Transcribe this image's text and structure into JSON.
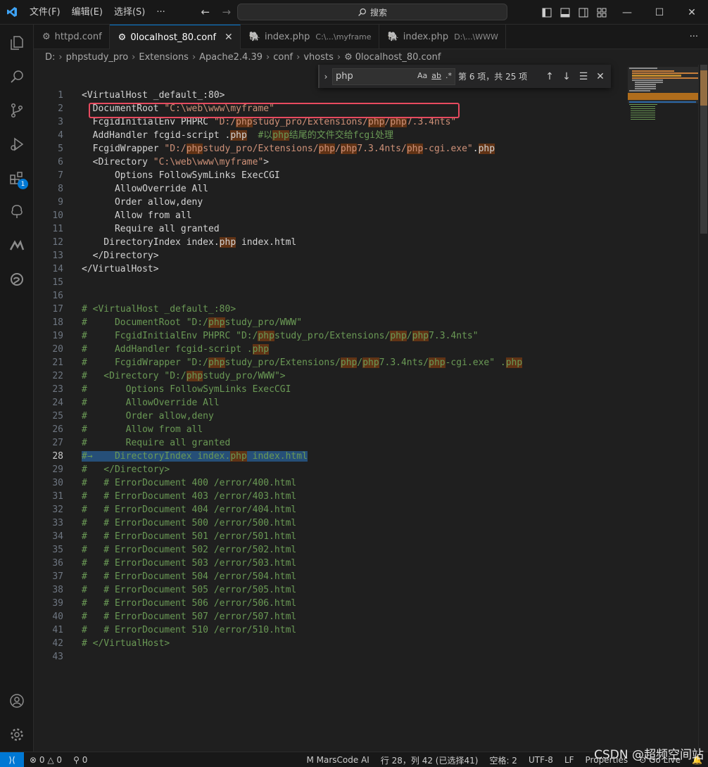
{
  "menu": [
    "文件(F)",
    "编辑(E)",
    "选择(S)",
    "···"
  ],
  "search": {
    "label": "搜索"
  },
  "tabs": [
    {
      "label": "httpd.conf",
      "path": ""
    },
    {
      "label": "0localhost_80.conf",
      "path": ""
    },
    {
      "label": "index.php",
      "path": "C:\\...\\myframe"
    },
    {
      "label": "index.php",
      "path": "D:\\...\\WWW"
    }
  ],
  "breadcrumb": [
    "D:",
    "phpstudy_pro",
    "Extensions",
    "Apache2.4.39",
    "conf",
    "vhosts",
    "0localhost_80.conf"
  ],
  "find": {
    "query": "php",
    "count": "第 6 项，共 25 项"
  },
  "activity_badge": "1",
  "colors": {
    "accent": "#0078d4",
    "comment": "#6a9955",
    "string": "#ce9178",
    "highlight_box": "#e84a5f",
    "match": "#613315"
  },
  "code_lines": [
    {
      "n": "1",
      "t": "<VirtualHost _default_:80>"
    },
    {
      "n": "2",
      "t": "  DocumentRoot \"C:\\web\\www\\myframe\""
    },
    {
      "n": "3",
      "t": "  FcgidInitialEnv PHPRC \"D:/phpstudy_pro/Extensions/php/php7.3.4nts\""
    },
    {
      "n": "4",
      "t": "  AddHandler fcgid-script .php  #以php结尾的文件交给fcgi处理"
    },
    {
      "n": "5",
      "t": "  FcgidWrapper \"D:/phpstudy_pro/Extensions/php/php7.3.4nts/php-cgi.exe\".php"
    },
    {
      "n": "6",
      "t": "  <Directory \"C:\\web\\www\\myframe\">"
    },
    {
      "n": "7",
      "t": "      Options FollowSymLinks ExecCGI"
    },
    {
      "n": "8",
      "t": "      AllowOverride All"
    },
    {
      "n": "9",
      "t": "      Order allow,deny"
    },
    {
      "n": "10",
      "t": "      Allow from all"
    },
    {
      "n": "11",
      "t": "      Require all granted"
    },
    {
      "n": "12",
      "t": "    DirectoryIndex index.php index.html"
    },
    {
      "n": "13",
      "t": "  </Directory>"
    },
    {
      "n": "14",
      "t": "</VirtualHost>"
    },
    {
      "n": "15",
      "t": ""
    },
    {
      "n": "16",
      "t": ""
    },
    {
      "n": "17",
      "t": "# <VirtualHost _default_:80>"
    },
    {
      "n": "18",
      "t": "#     DocumentRoot \"D:/phpstudy_pro/WWW\""
    },
    {
      "n": "19",
      "t": "#     FcgidInitialEnv PHPRC \"D:/phpstudy_pro/Extensions/php/php7.3.4nts\""
    },
    {
      "n": "20",
      "t": "#     AddHandler fcgid-script .php"
    },
    {
      "n": "21",
      "t": "#     FcgidWrapper \"D:/phpstudy_pro/Extensions/php/php7.3.4nts/php-cgi.exe\" .php"
    },
    {
      "n": "22",
      "t": "#   <Directory \"D:/phpstudy_pro/WWW\">"
    },
    {
      "n": "23",
      "t": "#       Options FollowSymLinks ExecCGI"
    },
    {
      "n": "24",
      "t": "#       AllowOverride All"
    },
    {
      "n": "25",
      "t": "#       Order allow,deny"
    },
    {
      "n": "26",
      "t": "#       Allow from all"
    },
    {
      "n": "27",
      "t": "#       Require all granted"
    },
    {
      "n": "28",
      "t": "#→    DirectoryIndex index.php index.html"
    },
    {
      "n": "29",
      "t": "#   </Directory>"
    },
    {
      "n": "30",
      "t": "#   # ErrorDocument 400 /error/400.html"
    },
    {
      "n": "31",
      "t": "#   # ErrorDocument 403 /error/403.html"
    },
    {
      "n": "32",
      "t": "#   # ErrorDocument 404 /error/404.html"
    },
    {
      "n": "33",
      "t": "#   # ErrorDocument 500 /error/500.html"
    },
    {
      "n": "34",
      "t": "#   # ErrorDocument 501 /error/501.html"
    },
    {
      "n": "35",
      "t": "#   # ErrorDocument 502 /error/502.html"
    },
    {
      "n": "36",
      "t": "#   # ErrorDocument 503 /error/503.html"
    },
    {
      "n": "37",
      "t": "#   # ErrorDocument 504 /error/504.html"
    },
    {
      "n": "38",
      "t": "#   # ErrorDocument 505 /error/505.html"
    },
    {
      "n": "39",
      "t": "#   # ErrorDocument 506 /error/506.html"
    },
    {
      "n": "40",
      "t": "#   # ErrorDocument 507 /error/507.html"
    },
    {
      "n": "41",
      "t": "#   # ErrorDocument 510 /error/510.html"
    },
    {
      "n": "42",
      "t": "# </VirtualHost>"
    },
    {
      "n": "43",
      "t": ""
    }
  ],
  "status": {
    "errors": "0",
    "warnings": "0",
    "ports": "0",
    "marscode": "MarsCode AI",
    "position": "行 28，列 42 (已选择41)",
    "spaces": "空格: 2",
    "encoding": "UTF-8",
    "eol": "LF",
    "lang": "Properties",
    "golive": "Go Live"
  },
  "watermark": "CSDN @超频空间站"
}
